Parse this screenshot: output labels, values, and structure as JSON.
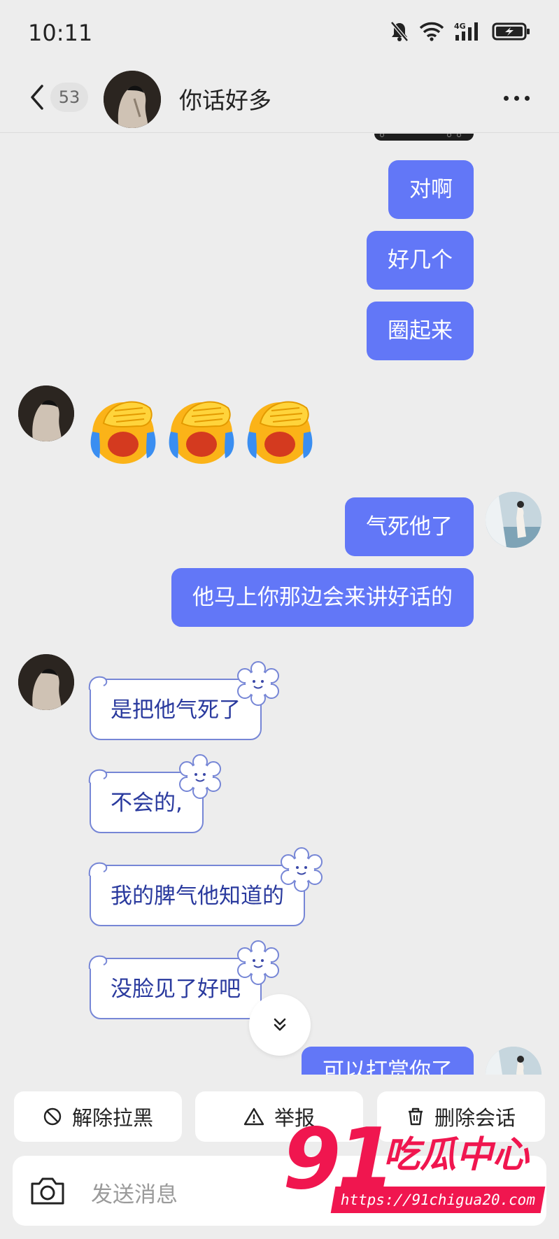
{
  "status_bar": {
    "time": "10:11",
    "network": "4G"
  },
  "header": {
    "unread_count": "53",
    "title": "你话好多"
  },
  "messages": {
    "out_1": "对啊",
    "out_2": "好几个",
    "out_3": "圈起来",
    "out_4": "气死他了",
    "out_5": "他马上你那边会来讲好话的",
    "in_1": "是把他气死了",
    "in_2": "不会的,",
    "in_3": "我的脾气他知道的",
    "in_4": "没脸见了好吧",
    "out_6_partial": "可以打赏你了"
  },
  "emoji": {
    "name": "facepalm-laugh-cry-emoji",
    "count": 3
  },
  "actions": {
    "unblock": "解除拉黑",
    "report": "举报",
    "delete_chat": "删除会话"
  },
  "input": {
    "placeholder": "发送消息"
  },
  "watermark": {
    "brand_number": "91",
    "brand_name": "吃瓜中心",
    "url": "https://91chigua20.com"
  },
  "colors": {
    "outgoing_bubble": "#6277f7",
    "incoming_text": "#2a3a9e",
    "watermark": "#f0164f"
  }
}
